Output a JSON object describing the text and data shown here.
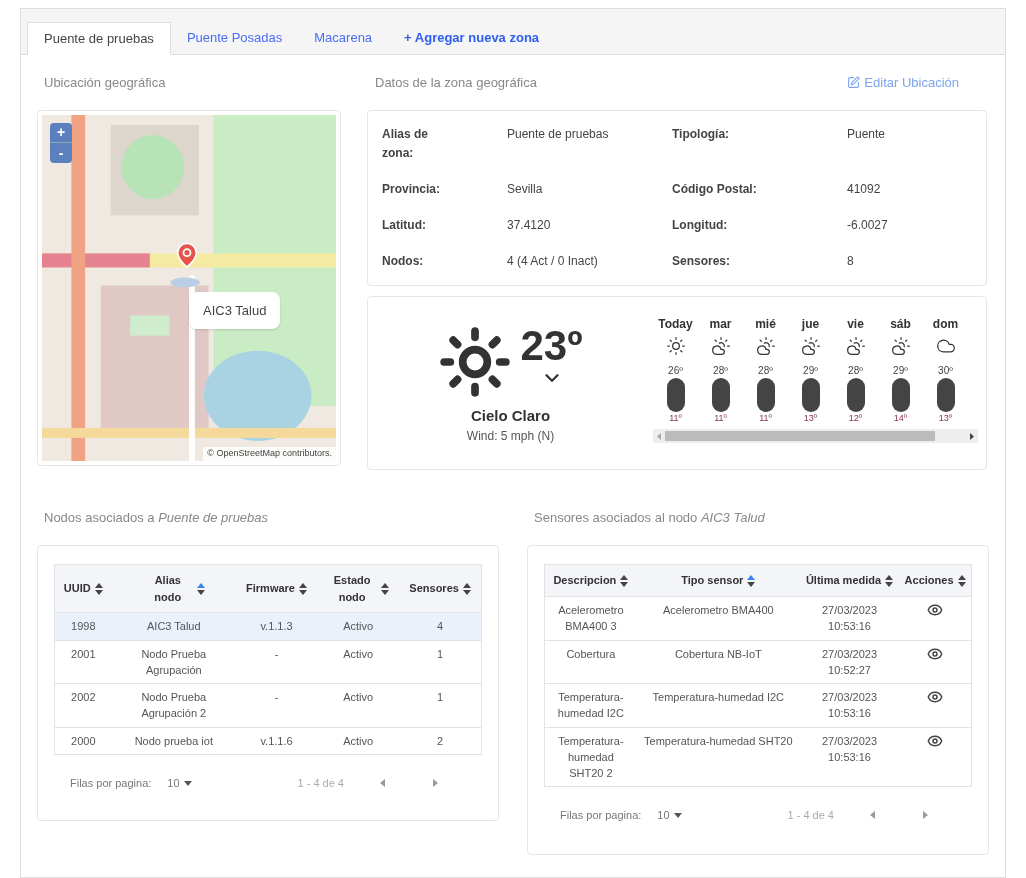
{
  "tabs": [
    {
      "label": "Puente de pruebas",
      "selected": true
    },
    {
      "label": "Puente Posadas",
      "selected": false
    },
    {
      "label": "Macarena",
      "selected": false
    }
  ],
  "add_zone": "+ Agregar nueva zona",
  "location": {
    "title": "Ubicación geográfica",
    "zoom_in": "+",
    "zoom_out": "-",
    "popup": "AIC3 Talud",
    "attribution": "© OpenStreetMap contributors."
  },
  "zone_data": {
    "title": "Datos de la zona geográfica",
    "edit_link": "Editar Ubicación",
    "fields": [
      {
        "label": "Alias de zona:",
        "value": "Puente de pruebas"
      },
      {
        "label": "Tipología:",
        "value": "Puente"
      },
      {
        "label": "Provincia:",
        "value": "Sevilla"
      },
      {
        "label": "Código Postal:",
        "value": "41092"
      },
      {
        "label": "Latitud:",
        "value": "37.4120"
      },
      {
        "label": "Longitud:",
        "value": "-6.0027"
      },
      {
        "label": "Nodos:",
        "value": "4 (4 Act / 0 Inact)"
      },
      {
        "label": "Sensores:",
        "value": "8"
      }
    ]
  },
  "weather": {
    "kind": "sun",
    "temperature": "23º",
    "condition": "Cielo Claro",
    "wind": "Wind: 5 mph (N)",
    "forecast": [
      {
        "day": "Today",
        "kind": "sun",
        "high": "26º",
        "low": "11º"
      },
      {
        "day": "mar",
        "kind": "partly-cloudy",
        "high": "28º",
        "low": "11º"
      },
      {
        "day": "mié",
        "kind": "partly-cloudy",
        "high": "28º",
        "low": "11º"
      },
      {
        "day": "jue",
        "kind": "partly-cloudy",
        "high": "29º",
        "low": "13º"
      },
      {
        "day": "vie",
        "kind": "partly-cloudy",
        "high": "28º",
        "low": "12º"
      },
      {
        "day": "sáb",
        "kind": "partly-cloudy",
        "high": "29º",
        "low": "14º"
      },
      {
        "day": "dom",
        "kind": "cloud",
        "high": "30º",
        "low": "13º"
      }
    ]
  },
  "nodes": {
    "title": "Nodos asociados a *Puente de pruebas*",
    "columns": [
      {
        "label": "UUID",
        "sorted": false
      },
      {
        "label": "Alias nodo",
        "sorted": true
      },
      {
        "label": "Firmware",
        "sorted": false
      },
      {
        "label": "Estado nodo",
        "sorted": false
      },
      {
        "label": "Sensores",
        "sorted": false
      }
    ],
    "rows": [
      {
        "selected": true,
        "cells": [
          "1998",
          "AIC3 Talud",
          "v.1.1.3",
          "Activo",
          "4"
        ]
      },
      {
        "selected": false,
        "cells": [
          "2001",
          "Nodo Prueba Agrupación",
          "-",
          "Activo",
          "1"
        ]
      },
      {
        "selected": false,
        "cells": [
          "2002",
          "Nodo Prueba Agrupación 2",
          "-",
          "Activo",
          "1"
        ]
      },
      {
        "selected": false,
        "cells": [
          "2000",
          "Nodo prueba iot",
          "v.1.1.6",
          "Activo",
          "2"
        ]
      }
    ],
    "rows_label": "Filas por pagina:",
    "rows_per_page": "10",
    "range": "1 - 4 de 4"
  },
  "sensors": {
    "title": "Sensores asociados al nodo *AIC3 Talud*",
    "columns": [
      {
        "label": "Descripcion",
        "sorted": false
      },
      {
        "label": "Tipo sensor",
        "sorted": true
      },
      {
        "label": "Última medida",
        "sorted": false
      },
      {
        "label": "Acciones",
        "sorted": false
      }
    ],
    "rows": [
      {
        "cells": [
          "Acelerometro BMA400 3",
          "Acelerometro BMA400",
          "27/03/2023 10:53:16"
        ]
      },
      {
        "cells": [
          "Cobertura",
          "Cobertura NB-IoT",
          "27/03/2023 10:52:27"
        ]
      },
      {
        "cells": [
          "Temperatura-humedad I2C",
          "Temperatura-humedad I2C",
          "27/03/2023 10:53:16"
        ]
      },
      {
        "cells": [
          "Temperatura-humedad SHT20 2",
          "Temperatura-humedad SHT20",
          "27/03/2023 10:53:16"
        ]
      }
    ],
    "rows_label": "Filas por pagina:",
    "rows_per_page": "10",
    "range": "1 - 4 de 4"
  }
}
